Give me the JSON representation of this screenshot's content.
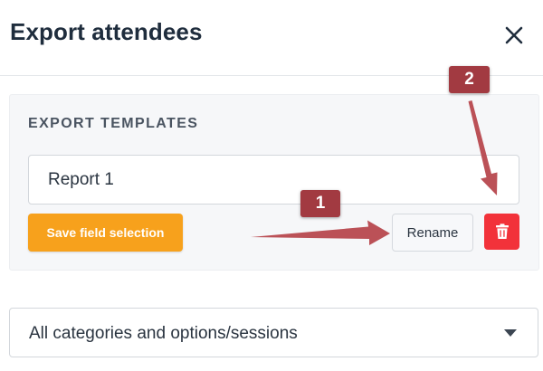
{
  "dialog": {
    "title": "Export attendees",
    "close_icon": "close-icon"
  },
  "templates": {
    "section_label": "EXPORT TEMPLATES",
    "template_name": "Report 1",
    "save_label": "Save field selection",
    "rename_label": "Rename",
    "delete_icon": "trash-icon"
  },
  "filter": {
    "selected": "All categories and options/sessions",
    "caret_icon": "caret-down-icon"
  },
  "annotations": {
    "badge_1": "1",
    "badge_2": "2"
  },
  "colors": {
    "accent_orange": "#f7a11c",
    "delete_red": "#f2323a",
    "annotation": "#a23a41"
  }
}
